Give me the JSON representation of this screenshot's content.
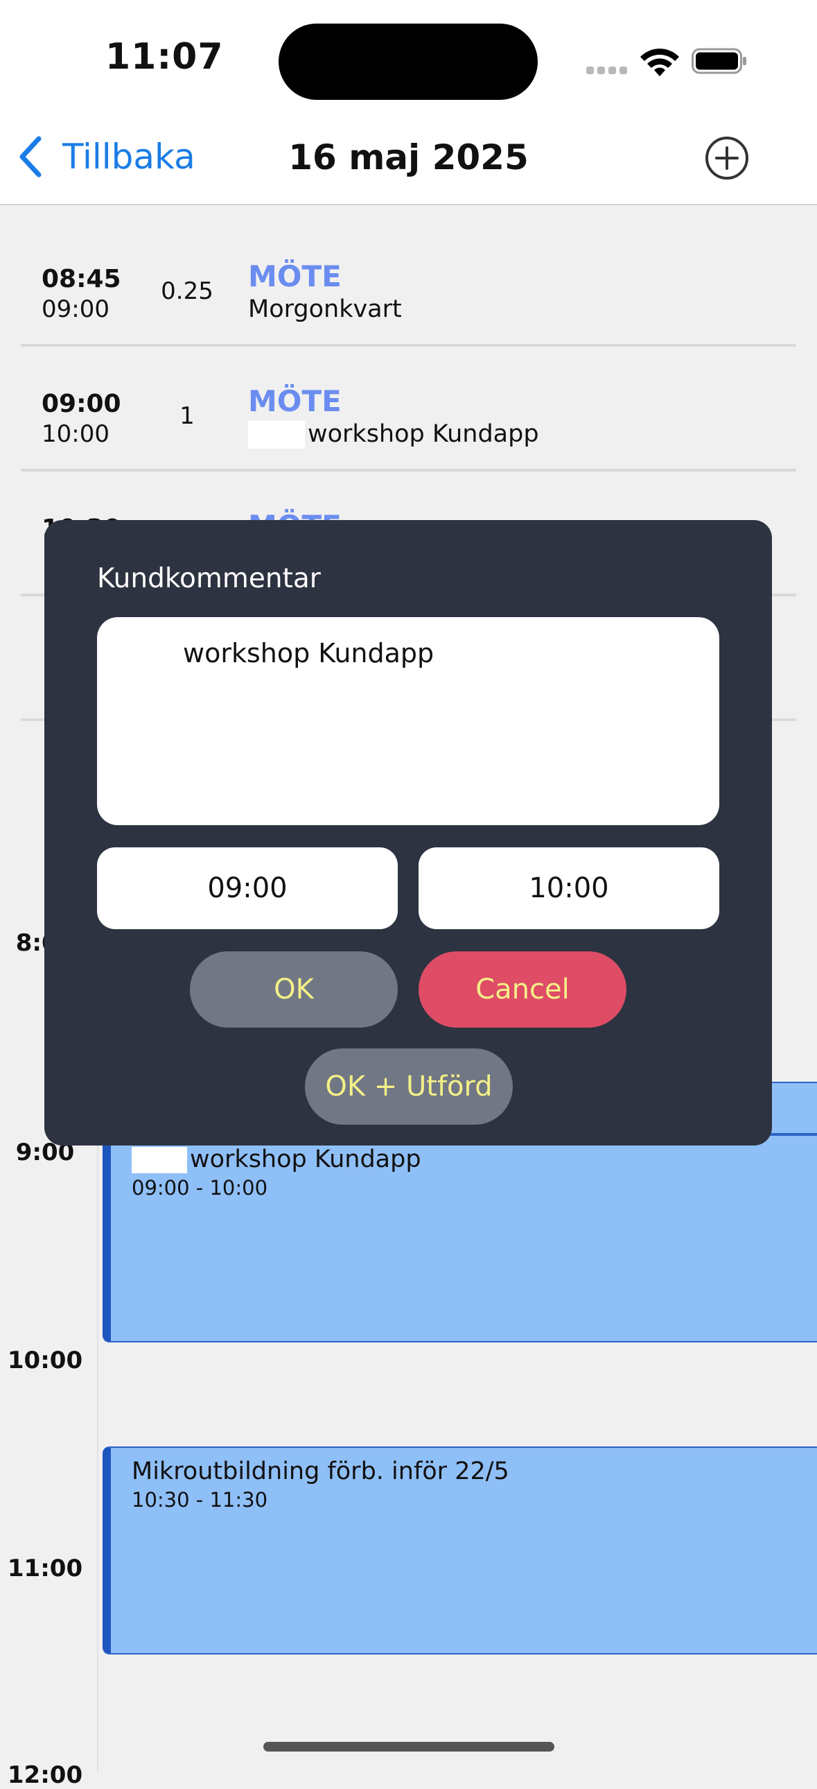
{
  "status_bar": {
    "time": "11:07"
  },
  "nav": {
    "back_label": "Tillbaka",
    "title": "16 maj 2025"
  },
  "entries": [
    {
      "start": "08:45",
      "end": "09:00",
      "duration": "0.25",
      "type": "MÖTE",
      "description": "Morgonkvart"
    },
    {
      "start": "09:00",
      "end": "10:00",
      "duration": "1",
      "type": "MÖTE",
      "description": "workshop Kundapp"
    },
    {
      "start": "10:30",
      "type": "MÖTE"
    }
  ],
  "calendar": {
    "hours": [
      "8:00",
      "9:00",
      "10:00",
      "11:00",
      "12:00"
    ],
    "events": [
      {
        "title": "workshop Kundapp",
        "range": "09:00 - 10:00"
      },
      {
        "title": "Mikroutbildning förb. inför 22/5",
        "range": "10:30 - 11:30"
      }
    ]
  },
  "modal": {
    "label": "Kundkommentar",
    "comment": "workshop Kundapp",
    "start_time": "09:00",
    "end_time": "10:00",
    "ok_label": "OK",
    "cancel_label": "Cancel",
    "ok_done_label": "OK + Utförd"
  },
  "colors": {
    "accent": "#1a7ce6",
    "meeting_type": "#6b8df0",
    "event_fill": "#8fbff7",
    "event_border": "#1e56c0",
    "modal_bg": "#2d3340",
    "cancel": "#df4c66",
    "button_text": "#f3f088"
  }
}
